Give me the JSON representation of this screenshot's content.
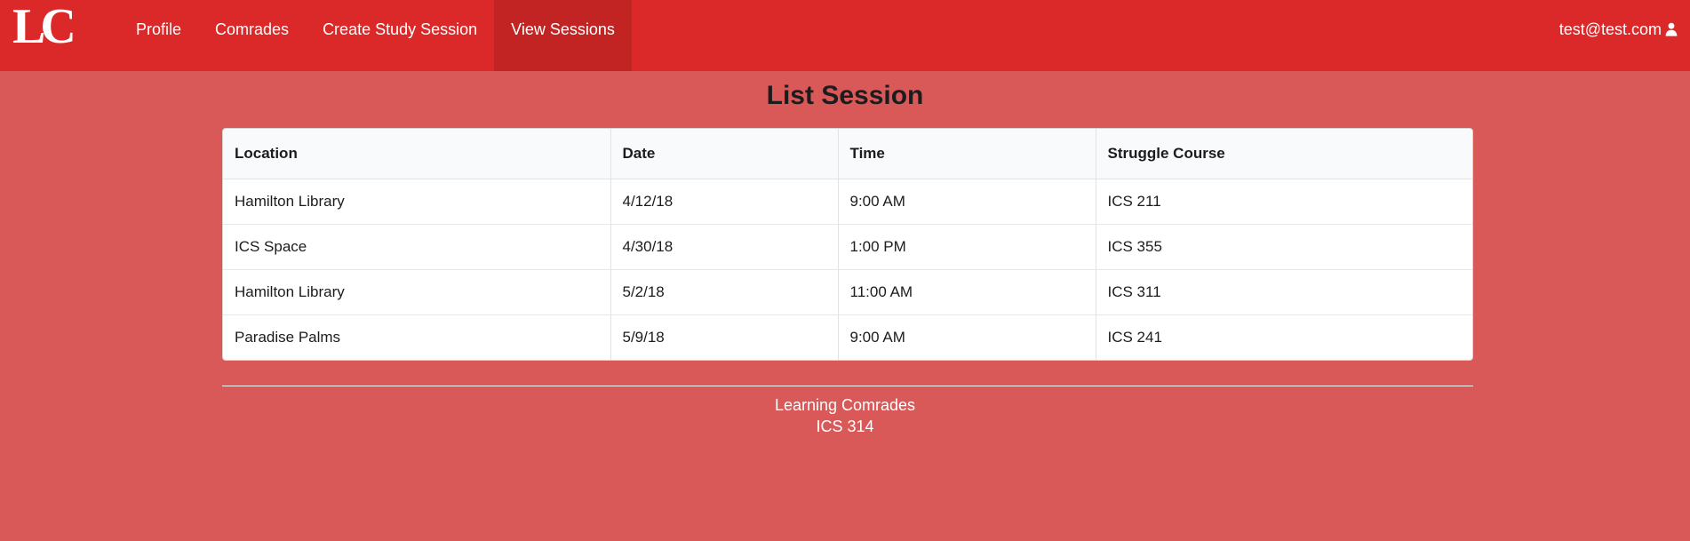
{
  "navbar": {
    "logo": "LC",
    "items": [
      {
        "label": "Profile"
      },
      {
        "label": "Comrades"
      },
      {
        "label": "Create Study Session"
      },
      {
        "label": "View Sessions"
      }
    ],
    "active_item": "View Sessions",
    "user_email": "test@test.com",
    "user_icon": "user-icon"
  },
  "page": {
    "title": "List Session"
  },
  "table": {
    "headers": [
      "Location",
      "Date",
      "Time",
      "Struggle Course"
    ],
    "rows": [
      [
        "Hamilton Library",
        "4/12/18",
        "9:00 AM",
        "ICS 211"
      ],
      [
        "ICS Space",
        "4/30/18",
        "1:00 PM",
        "ICS 355"
      ],
      [
        "Hamilton Library",
        "5/2/18",
        "11:00 AM",
        "ICS 311"
      ],
      [
        "Paradise Palms",
        "5/9/18",
        "9:00 AM",
        "ICS 241"
      ]
    ]
  },
  "footer": {
    "line1": "Learning Comrades",
    "line2": "ICS 314"
  },
  "colors": {
    "navbar": "#db2828",
    "active_nav": "#c22323",
    "page_background": "#d95858",
    "table_background": "#ffffff"
  }
}
